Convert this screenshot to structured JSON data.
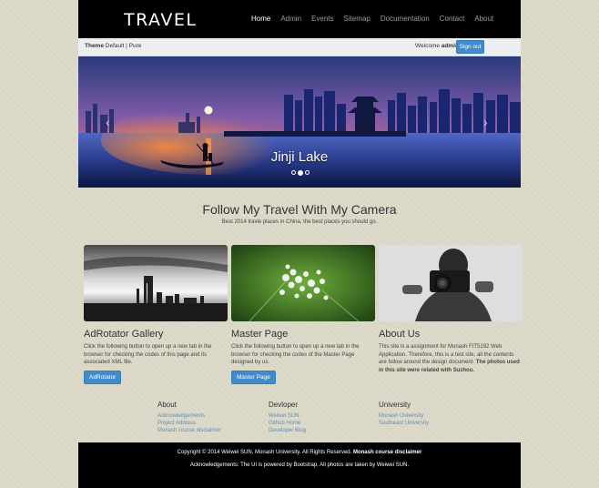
{
  "brand": "TRAVEL",
  "nav": {
    "items": [
      "Home",
      "Admin",
      "Events",
      "Sitemap",
      "Documentation",
      "Contact",
      "About"
    ]
  },
  "topbar": {
    "theme_label": "Theme",
    "theme_options": "Default | Pure",
    "welcome_label": "Welcome",
    "username": "admin",
    "signout_label": "Sign out"
  },
  "carousel": {
    "caption": "Jinji Lake",
    "prev_glyph": "‹",
    "next_glyph": "›",
    "active_slide": 2,
    "slide_count": 3
  },
  "intro": {
    "title": "Follow My Travel With My Camera",
    "subtitle": "Best 2014 travle places in China, the best places you should go."
  },
  "columns": [
    {
      "title": "AdRotator Gallery",
      "text": "Click the following button to open up a new tab in the browser for checking the codes of this page and its associated XML file.",
      "button": "AdRotator"
    },
    {
      "title": "Master Page",
      "text": "Click the following button to open up a new tab in the browser for checking the codes of the Master Page designed by us.",
      "button": "Master Page"
    },
    {
      "title": "About Us",
      "text": "This site is a assignment for Monash FIT5192 Web Application. Therefore, this is a test site, all the contents are follow around the design document.",
      "text_bold": "The photos used in this site were related with Suzhou."
    }
  ],
  "footer_links": {
    "about": {
      "title": "About",
      "links": [
        "Acknowledgements",
        "Project Address",
        "Monash course disclaimer"
      ]
    },
    "devloper": {
      "title": "Devloper",
      "links": [
        "Weiwei SUN",
        "Github Home",
        "Developer Blog"
      ]
    },
    "university": {
      "title": "University",
      "links": [
        "Monash University",
        "Southeast University"
      ]
    }
  },
  "footer": {
    "copyright": "Copyright © 2014 Weiwei SUN, Monash University. All Rights Reserved.",
    "disclaimer": "Monash course disclaimer",
    "acknowledgements": "Acknowledgements: The UI is powered by Bootstrap. All photos are taken by Weiwei SUN."
  },
  "colors": {
    "background": "#dddac9",
    "navbar": "#000000",
    "primary_button": "#428bca",
    "link": "#5a8fc6"
  }
}
